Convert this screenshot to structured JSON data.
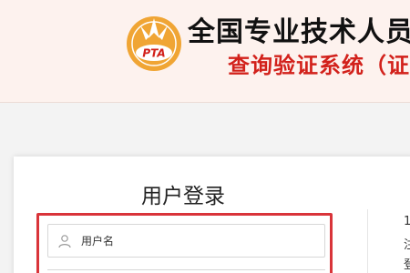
{
  "header": {
    "logo_text": "PTA",
    "title_main": "全国专业技术人员",
    "title_sub": "查询验证系统（证"
  },
  "login": {
    "title": "用户登录",
    "username_placeholder": "用户名"
  },
  "side_text": [
    "1",
    "注",
    "登"
  ],
  "colors": {
    "header_bg": "#fdf2ee",
    "logo_gold": "#f0a534",
    "subtitle_red": "#d2211b",
    "highlight_red": "#d9343a"
  }
}
